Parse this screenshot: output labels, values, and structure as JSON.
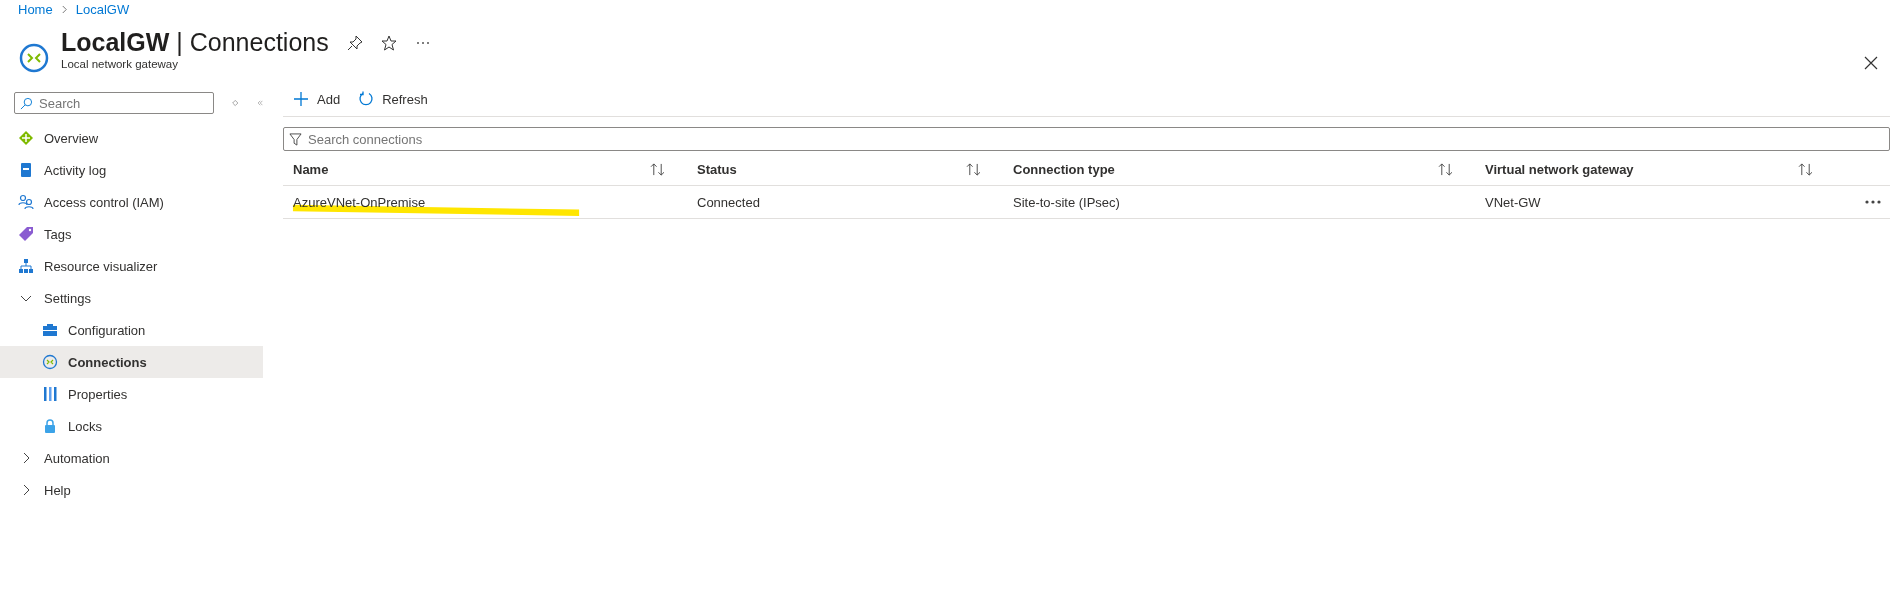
{
  "breadcrumb": [
    {
      "label": "Home"
    },
    {
      "label": "LocalGW"
    }
  ],
  "header": {
    "resource": "LocalGW",
    "separator": "|",
    "page": "Connections",
    "subtitle": "Local network gateway"
  },
  "sidebar": {
    "search": {
      "placeholder": "Search"
    },
    "items": [
      {
        "kind": "link",
        "label": "Overview",
        "selected": false
      },
      {
        "kind": "link",
        "label": "Activity log",
        "selected": false
      },
      {
        "kind": "link",
        "label": "Access control (IAM)",
        "selected": false
      },
      {
        "kind": "link",
        "label": "Tags",
        "selected": false
      },
      {
        "kind": "link",
        "label": "Resource visualizer",
        "selected": false
      },
      {
        "kind": "group",
        "label": "Settings",
        "expanded": true,
        "children": [
          {
            "label": "Configuration",
            "selected": false
          },
          {
            "label": "Connections",
            "selected": true
          },
          {
            "label": "Properties",
            "selected": false
          },
          {
            "label": "Locks",
            "selected": false
          }
        ]
      },
      {
        "kind": "group",
        "label": "Automation",
        "expanded": false
      },
      {
        "kind": "group",
        "label": "Help",
        "expanded": false
      }
    ]
  },
  "toolbar": [
    {
      "label": "Add"
    },
    {
      "label": "Refresh"
    }
  ],
  "filter": {
    "placeholder": "Search connections"
  },
  "table": {
    "columns": [
      "Name",
      "Status",
      "Connection type",
      "Virtual network gateway"
    ],
    "rows": [
      {
        "cells": [
          "AzureVNet-OnPremise",
          "Connected",
          "Site-to-site (IPsec)",
          "VNet-GW"
        ],
        "highlighted": true
      }
    ]
  }
}
